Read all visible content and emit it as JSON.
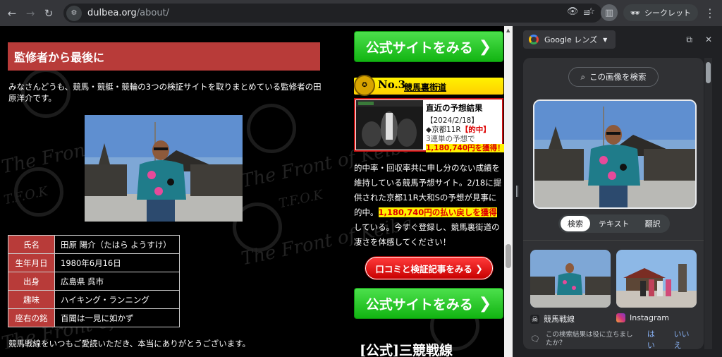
{
  "browser": {
    "url_host": "dulbea.org",
    "url_path": "/about/",
    "incognito_label": "シークレット"
  },
  "page": {
    "section_heading": "監修者から最後に",
    "intro_text": "みなさんどうも、競馬・競艇・競輪の3つの検証サイトを取りまとめている監修者の田原洋介です。",
    "profile": [
      {
        "key": "氏名",
        "value": "田原 陽介（たはら ようすけ）"
      },
      {
        "key": "生年月日",
        "value": "1980年6月16日"
      },
      {
        "key": "出身",
        "value": "広島県 呉市"
      },
      {
        "key": "趣味",
        "value": "ハイキング・ランニング"
      },
      {
        "key": "座右の銘",
        "value": "百聞は一見に如かず"
      }
    ],
    "outro_text": "競馬戦線をいつもご愛読いただき、本当にありがとうございます。",
    "watermark": "The Front of Keiba",
    "watermark_short": "T.F.O.K"
  },
  "right_column": {
    "official_btn_label": "公式サイトをみる",
    "rank_number": "No.3",
    "rank_site_name": "競馬裏街道",
    "result_title": "直近の予想結果",
    "result_date": "【2024/2/18】",
    "result_race_prefix": "◆京都11R",
    "result_race_badge": "【的中】",
    "result_bet": "3連単の予想で",
    "result_amount": "1,180,740円を獲得！",
    "thumb_label": "競馬裏街道",
    "para_part1": "的中率・回収率共に申し分のない成績を維持している競馬予想サイト。2/18に提供された京都11R大和Sの予想が見事に的中。",
    "para_highlight": "1,180,740円の払い戻しを獲得",
    "para_part2": "している。今すぐ登録し、競馬裏街道の凄さを体感してください！",
    "review_btn_label": "口コミと検証記事をみる",
    "bottom_title": "[公式]三競戦線"
  },
  "lens": {
    "title": "Google レンズ",
    "search_image_label": "この画像を検索",
    "tabs": [
      "検索",
      "テキスト",
      "翻訳"
    ],
    "results": [
      {
        "source": "競馬戦線"
      },
      {
        "source": "Instagram"
      }
    ],
    "feedback_question": "この検索結果は役に立ちましたか？",
    "feedback_yes": "はい",
    "feedback_no": "いいえ"
  },
  "colors": {
    "heading_red": "#b83b39",
    "button_green": "#12b412",
    "highlight_yellow": "#fff200"
  }
}
